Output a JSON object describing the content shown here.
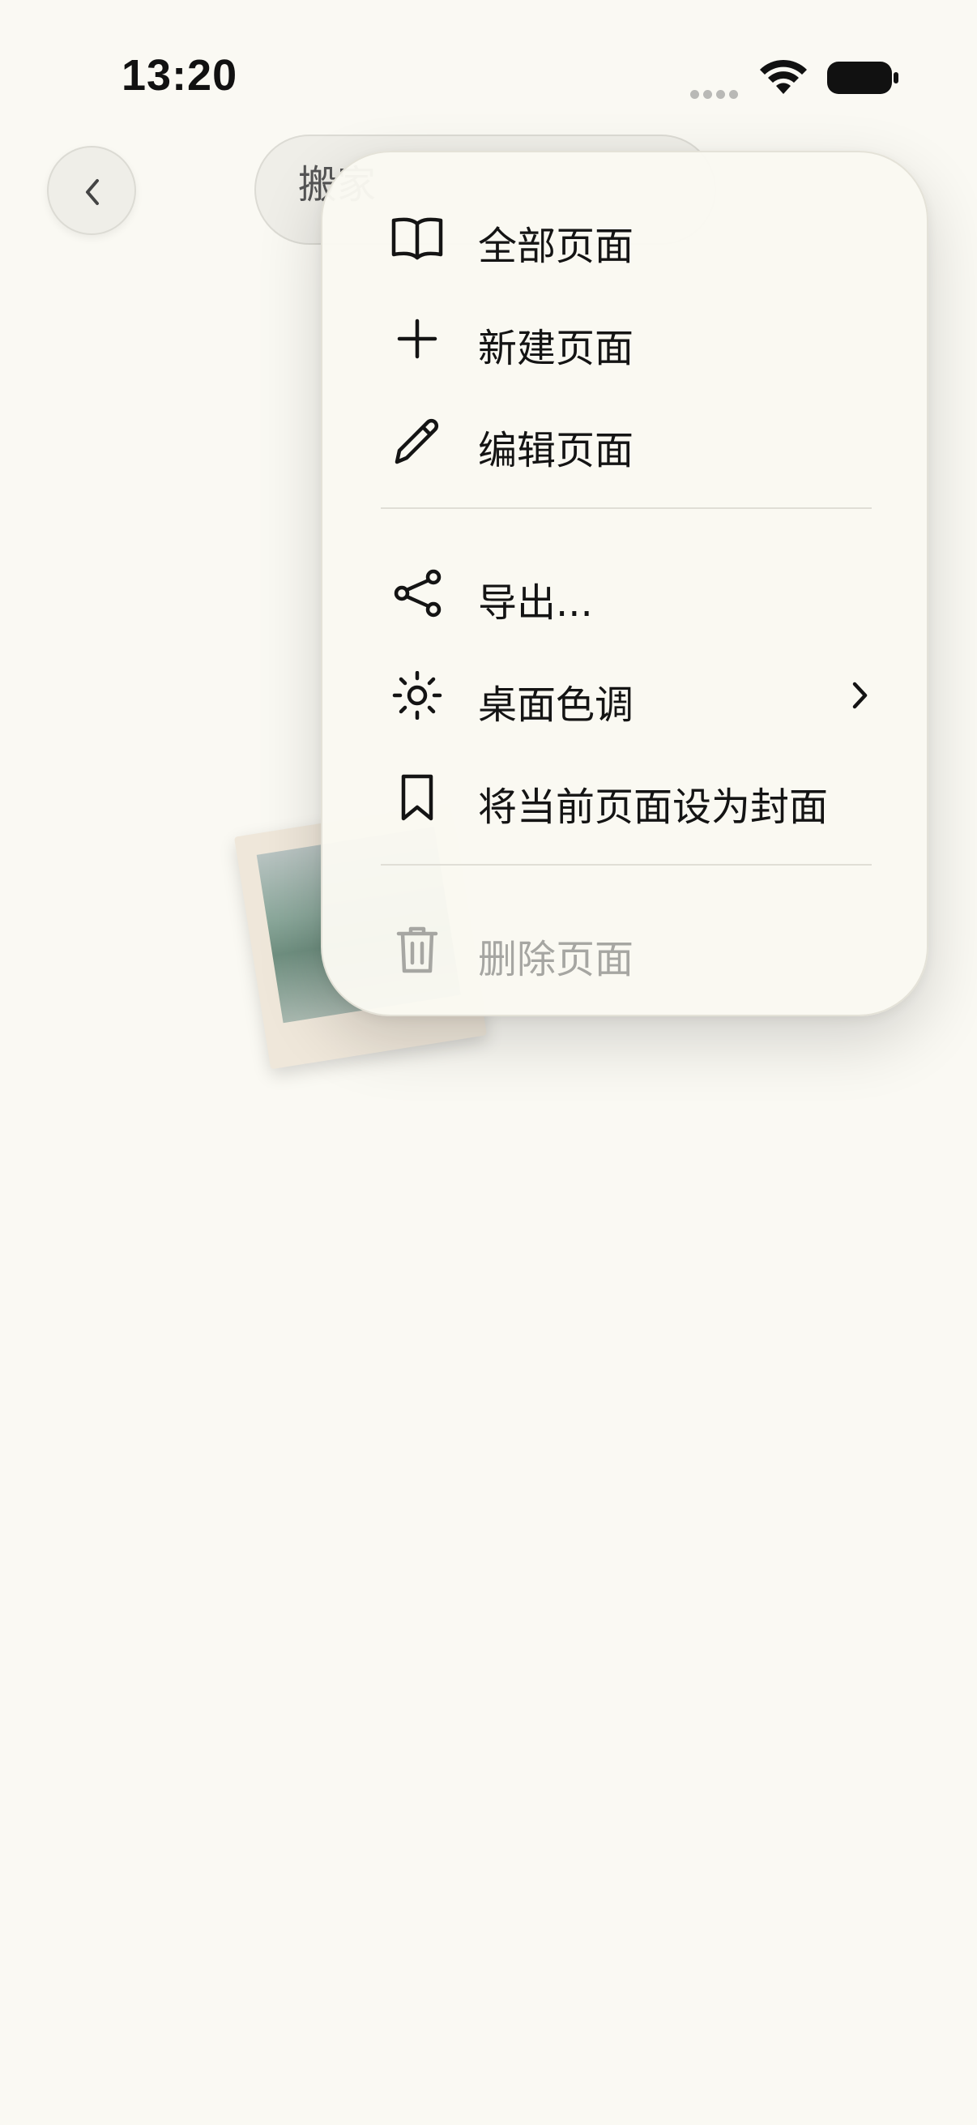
{
  "status_bar": {
    "time": "13:20",
    "icons": [
      "signal-dots-icon",
      "wifi-icon",
      "battery-icon"
    ]
  },
  "header": {
    "back_icon": "chevron-left-icon",
    "title": "搬家"
  },
  "menu": {
    "items": [
      {
        "label": "全部页面",
        "icon": "book-icon"
      },
      {
        "label": "新建页面",
        "icon": "plus-icon"
      },
      {
        "label": "编辑页面",
        "icon": "pencil-icon"
      },
      {
        "label": "导出...",
        "icon": "share-icon"
      },
      {
        "label": "桌面色调",
        "icon": "sun-icon",
        "has_submenu": true
      },
      {
        "label": "将当前页面设为封面",
        "icon": "bookmark-icon"
      },
      {
        "label": "删除页面",
        "icon": "trash-icon",
        "disabled": true
      }
    ]
  },
  "colors": {
    "background": "#faf9f3",
    "menu_background": "#faf9f2",
    "text": "#141414",
    "disabled_text": "#a6a6a2"
  }
}
